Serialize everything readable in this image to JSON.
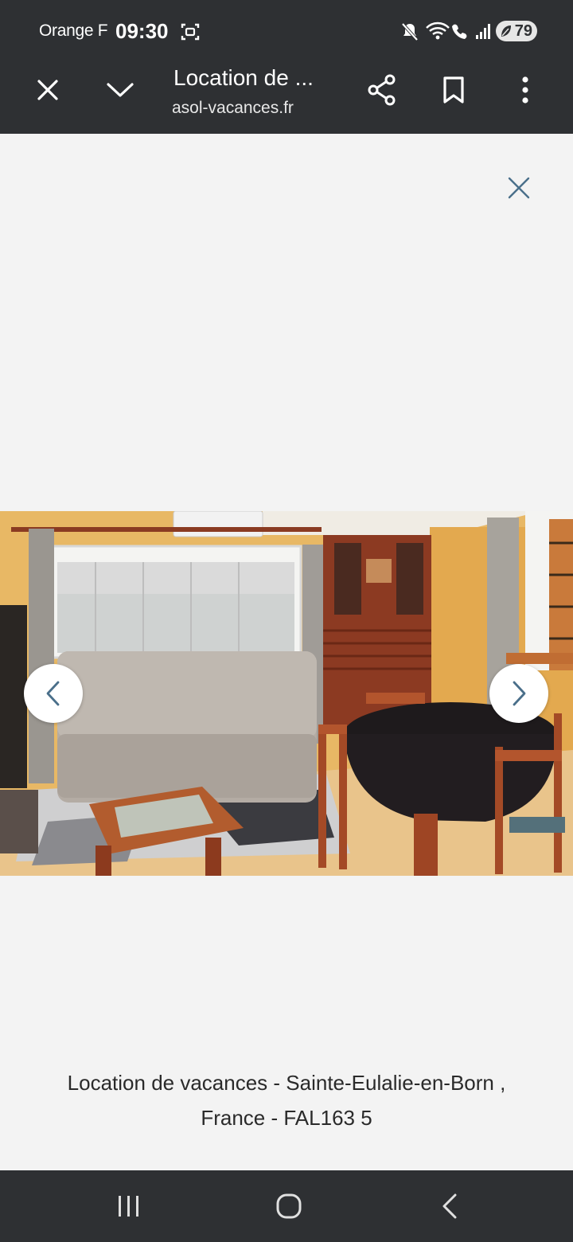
{
  "status_bar": {
    "carrier": "Orange F",
    "time": "09:30",
    "battery": "79",
    "icons": [
      "screen-record-icon",
      "mute-icon",
      "wifi-calling-icon",
      "signal-icon",
      "battery-icon"
    ]
  },
  "toolbar": {
    "title": "Location de ...",
    "url": "asol-vacances.fr",
    "icons": [
      "close-icon",
      "chevron-down-icon",
      "share-icon",
      "bookmark-icon",
      "more-vert-icon"
    ]
  },
  "viewer": {
    "caption_line1": "Location de vacances - Sainte-Eulalie-en-Born ,",
    "caption_line2": "France - FAL163 5",
    "icons": [
      "close-icon",
      "chevron-left-icon",
      "chevron-right-icon"
    ]
  },
  "nav_bar": {
    "icons": [
      "recents-icon",
      "home-icon",
      "back-icon"
    ]
  },
  "colors": {
    "bar_bg": "#2e3033",
    "page_bg": "#f3f3f3",
    "accent": "#4a6f8a"
  }
}
